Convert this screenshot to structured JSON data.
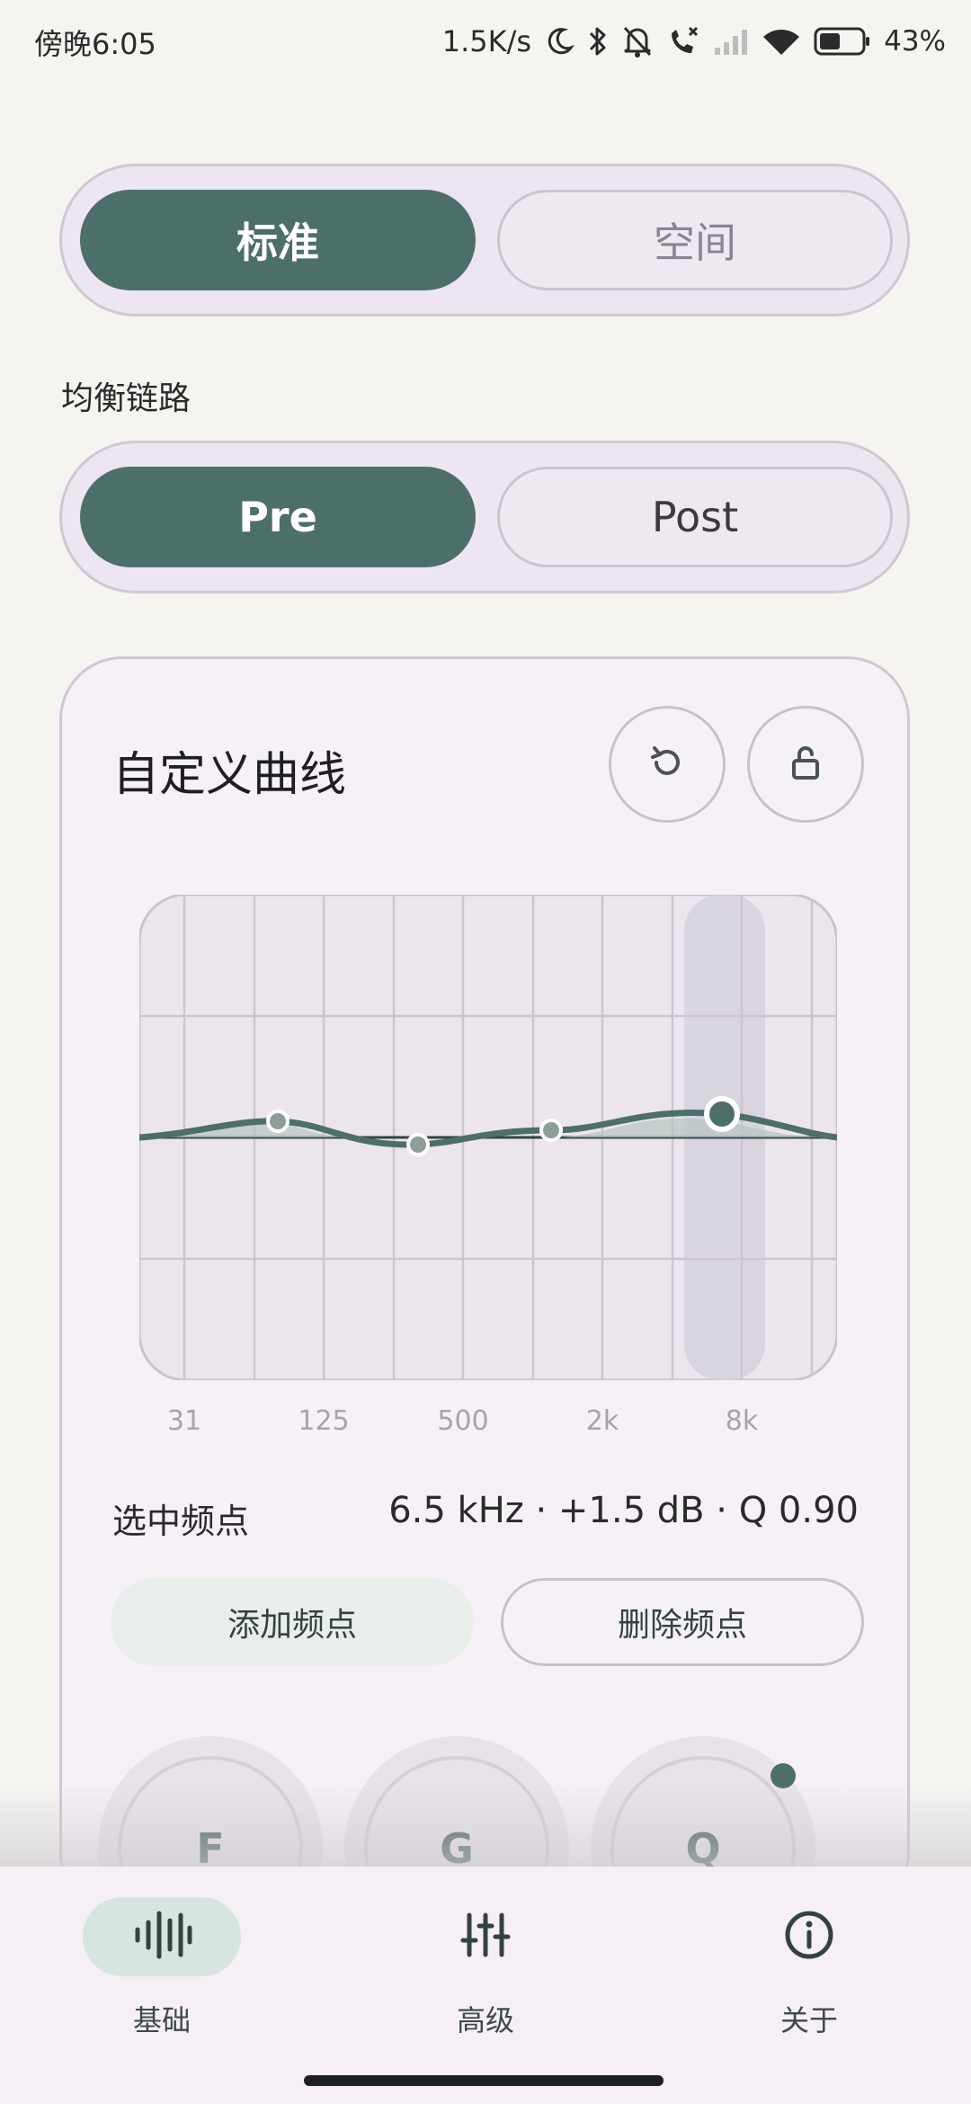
{
  "status_bar": {
    "time": "傍晚6:05",
    "net_speed": "1.5K/s",
    "battery": "43%",
    "icons": [
      "moon-icon",
      "bluetooth-icon",
      "bell-off-icon",
      "call-off-icon",
      "cellular-signal-icon",
      "wifi-icon",
      "battery-icon"
    ]
  },
  "mode_segment": {
    "options": [
      {
        "label": "标准",
        "active": true
      },
      {
        "label": "空间",
        "active": false
      }
    ]
  },
  "chain": {
    "label": "均衡链路",
    "options": [
      {
        "label": "Pre",
        "active": true
      },
      {
        "label": "Post",
        "active": false
      }
    ]
  },
  "curve_card": {
    "title": "自定义曲线",
    "reset_icon": "reset-icon",
    "lock_icon": "unlock-icon",
    "freq_labels": [
      "31",
      "125",
      "500",
      "2k",
      "8k"
    ],
    "selected_label": "选中频点",
    "selected_value": "6.5 kHz · +1.5 dB · Q 0.90",
    "add_button": "添加频点",
    "delete_button": "删除频点",
    "knobs": [
      "F",
      "G",
      "Q"
    ]
  },
  "bottom_nav": {
    "items": [
      {
        "label": "基础",
        "icon": "waveform-icon",
        "active": true
      },
      {
        "label": "高级",
        "icon": "sliders-icon",
        "active": false
      },
      {
        "label": "关于",
        "icon": "info-icon",
        "active": false
      }
    ]
  },
  "colors": {
    "accent": "#4d6f69",
    "background": "#f5f4f1",
    "card": "#f6f1f7"
  }
}
